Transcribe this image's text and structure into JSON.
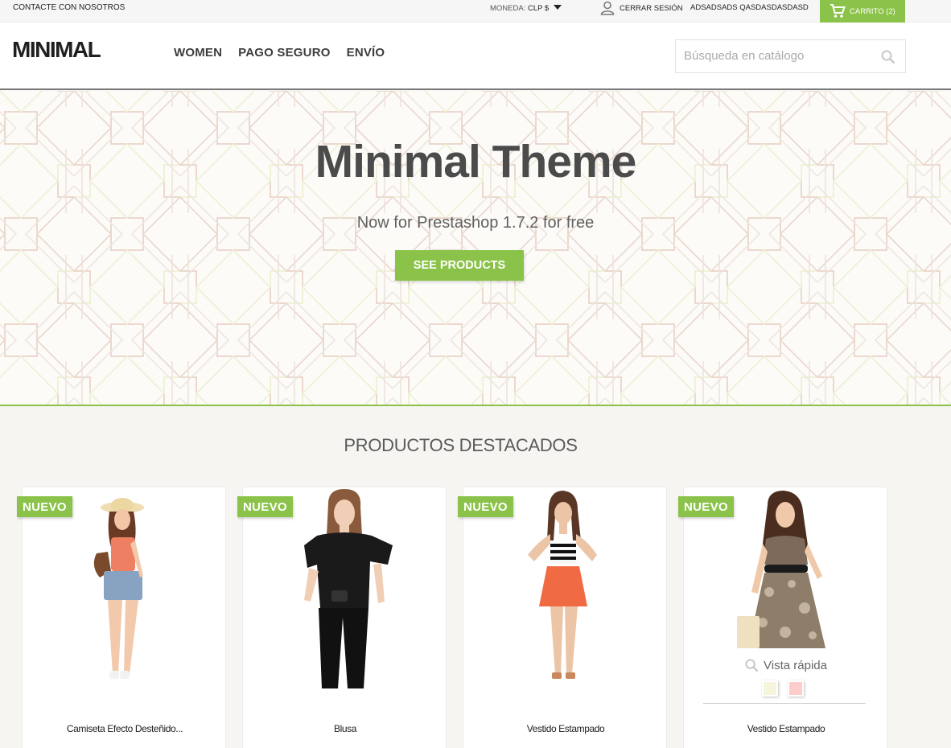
{
  "topbar": {
    "contact": "CONTACTE CON NOSOTROS",
    "currency_label": "MONEDA:",
    "currency_value": "CLP $",
    "logout": "CERRAR SESIÓN",
    "username": "ADSADSADS QASDASDASDASD",
    "cart": "CARRITO (2)"
  },
  "header": {
    "logo": "MINIMAL",
    "nav": [
      "WOMEN",
      "PAGO SEGURO",
      "ENVÍO"
    ],
    "search_placeholder": "Búsqueda en catálogo"
  },
  "hero": {
    "title": "Minimal Theme",
    "subtitle": "Now for Prestashop 1.7.2 for free",
    "button": "SEE PRODUCTS"
  },
  "products": {
    "title": "PRODUCTOS DESTACADOS",
    "badge": "NUEVO",
    "quick_view": "Vista rápida",
    "items": [
      {
        "name": "Camiseta Efecto Desteñido..."
      },
      {
        "name": "Blusa"
      },
      {
        "name": "Vestido Estampado"
      },
      {
        "name": "Vestido Estampado"
      }
    ],
    "swatch_colors": [
      "#f5f5dc",
      "#fcc"
    ]
  },
  "colors": {
    "accent": "#8bc34a",
    "text": "#414141"
  }
}
